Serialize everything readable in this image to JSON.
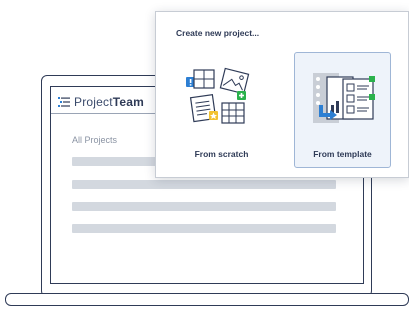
{
  "app": {
    "brand_part1": "Project",
    "brand_part2": "Team",
    "logo_icon": "list-lines-icon"
  },
  "main": {
    "section_title": "All Projects",
    "rows": [
      "",
      "",
      "",
      ""
    ]
  },
  "popup": {
    "title": "Create new project...",
    "options": [
      {
        "label": "From scratch",
        "icon": "scratch-collage-icon",
        "selected": false
      },
      {
        "label": "From template",
        "icon": "template-documents-icon",
        "selected": true
      }
    ]
  },
  "colors": {
    "navy": "#2f3b57",
    "accent_blue": "#2d7fd3",
    "accent_green": "#2bb24c",
    "accent_yellow": "#f2c230",
    "selected_bg": "#eef3fa",
    "selected_border": "#9fb6d6",
    "row_gray": "#d3d8df"
  }
}
